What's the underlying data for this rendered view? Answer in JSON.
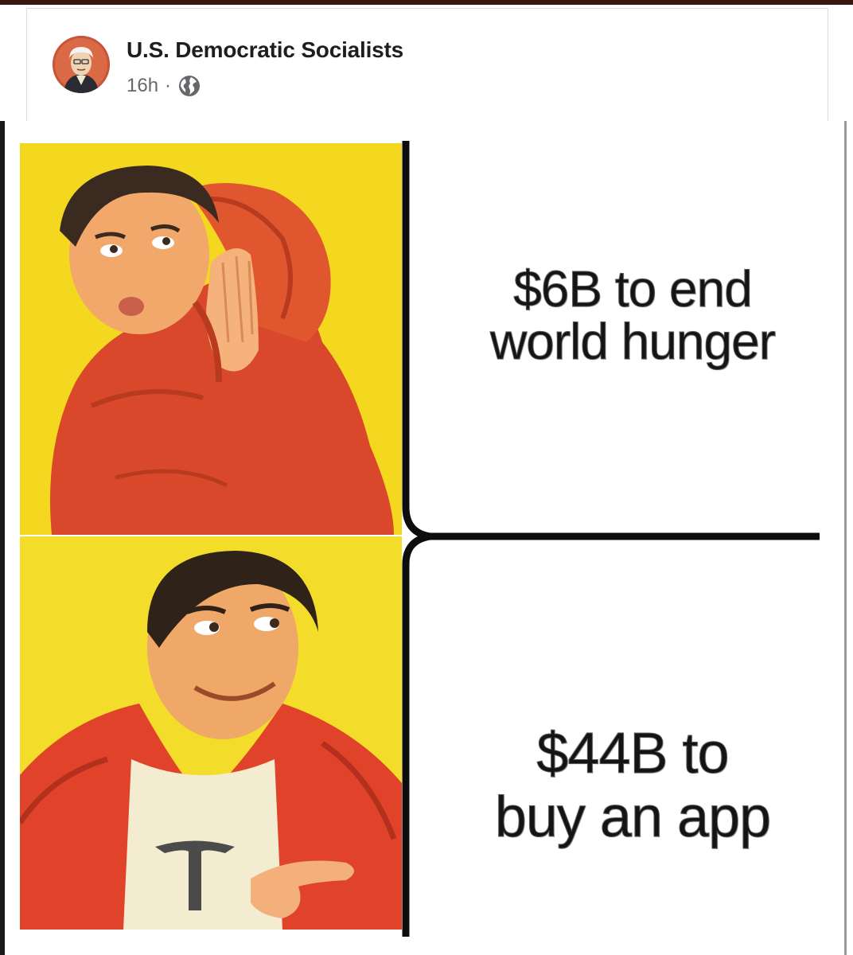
{
  "post": {
    "page_name": "U.S. Democratic Socialists",
    "timestamp": "16h",
    "separator": "·",
    "audience_icon": "globe-icon"
  },
  "meme": {
    "top_caption_line1": "$6B to end",
    "top_caption_line2": "world hunger",
    "bottom_caption_line1": "$44B to",
    "bottom_caption_line2": "buy an app"
  },
  "colors": {
    "top_bar": "#3a1512",
    "panel_yellow": "#f3d81f",
    "jacket_orange": "#e0512a",
    "name_text": "#1c1e21",
    "meta_text": "#65676b"
  }
}
